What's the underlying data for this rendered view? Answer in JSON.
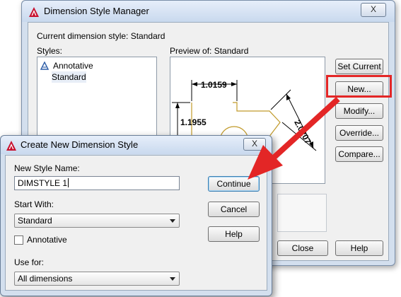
{
  "manager": {
    "title": "Dimension Style Manager",
    "close_label": "X",
    "current_style_label": "Current dimension style: Standard",
    "styles_label": "Styles:",
    "styles": [
      "Annotative",
      "Standard"
    ],
    "preview_label": "Preview of: Standard",
    "preview": {
      "dim_top": "1.0159",
      "dim_left": "1.1955",
      "dim_right": "2.0207"
    },
    "buttons": {
      "set_current": "Set Current",
      "new": "New...",
      "modify": "Modify...",
      "override": "Override...",
      "compare": "Compare...",
      "close": "Close",
      "help": "Help"
    }
  },
  "create_dialog": {
    "title": "Create New Dimension Style",
    "close_label": "X",
    "new_style_name_label": "New Style Name:",
    "new_style_name_value": "DIMSTYLE 1",
    "start_with_label": "Start With:",
    "start_with_value": "Standard",
    "annotative_label": "Annotative",
    "annotative_checked": false,
    "use_for_label": "Use for:",
    "use_for_value": "All dimensions",
    "buttons": {
      "continue": "Continue",
      "cancel": "Cancel",
      "help": "Help"
    }
  },
  "colors": {
    "highlight_red": "#e32626",
    "autocad_red": "#c8102e"
  },
  "icons": [
    "autocad-logo-icon",
    "annotative-icon",
    "close-icon",
    "dropdown-arrow-icon",
    "callout-arrow-icon"
  ]
}
